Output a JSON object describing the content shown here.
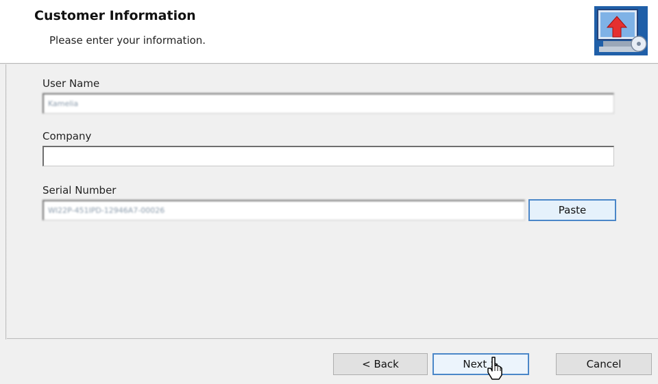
{
  "header": {
    "title": "Customer Information",
    "subtitle": "Please enter your information."
  },
  "form": {
    "user_name": {
      "label": "User Name",
      "value": "Kamelia"
    },
    "company": {
      "label": "Company",
      "value": ""
    },
    "serial_number": {
      "label": "Serial Number",
      "value": "WI22P-451IPD-12946A7-00026"
    },
    "paste_label": "Paste"
  },
  "footer": {
    "back_label": "< Back",
    "next_label": "Next >",
    "cancel_label": "Cancel"
  },
  "colors": {
    "focus_border": "#4a86c8",
    "header_bg": "#ffffff",
    "body_bg": "#f0f0f0"
  }
}
